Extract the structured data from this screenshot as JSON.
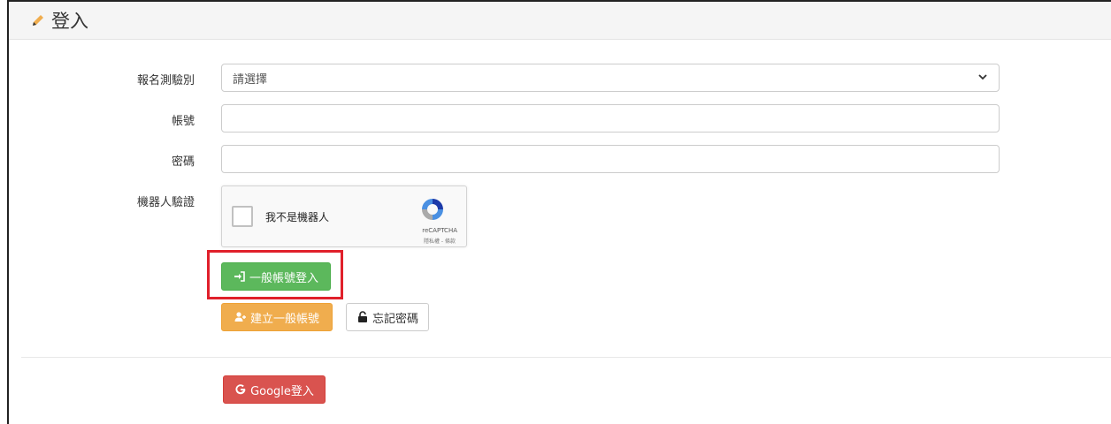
{
  "header": {
    "title": "登入",
    "icon": "pencil-icon",
    "icon_color": "#f0ad4e"
  },
  "form": {
    "exam_type": {
      "label": "報名測驗別",
      "selected": "請選擇"
    },
    "account": {
      "label": "帳號",
      "value": "",
      "placeholder": ""
    },
    "password": {
      "label": "密碼",
      "value": "",
      "placeholder": ""
    },
    "captcha": {
      "label": "機器人驗證",
      "checkbox_text": "我不是機器人",
      "brand": "reCAPTCHA",
      "terms": "隱私權 - 條款"
    }
  },
  "buttons": {
    "login": {
      "label": "一般帳號登入",
      "icon": "sign-in-icon",
      "color": "#5cb85c"
    },
    "register": {
      "label": "建立一般帳號",
      "icon": "user-plus-icon",
      "color": "#f0ad4e"
    },
    "forgot": {
      "label": "忘記密碼",
      "icon": "lock-icon"
    },
    "google": {
      "label": "Google登入",
      "icon": "google-icon",
      "color": "#d9534f"
    }
  },
  "highlight_color": "#e0202b"
}
